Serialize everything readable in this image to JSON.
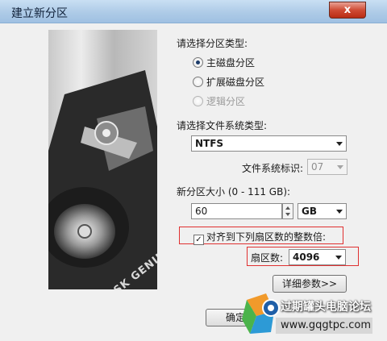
{
  "window": {
    "title": "建立新分区",
    "close_label": "x"
  },
  "side_image": {
    "brand": "DISK GENIUS"
  },
  "partition_type": {
    "label": "请选择分区类型:",
    "options": [
      {
        "label": "主磁盘分区",
        "checked": true,
        "enabled": true
      },
      {
        "label": "扩展磁盘分区",
        "checked": false,
        "enabled": true
      },
      {
        "label": "逻辑分区",
        "checked": false,
        "enabled": false
      }
    ]
  },
  "filesystem": {
    "label": "请选择文件系统类型:",
    "selected": "NTFS",
    "id_label": "文件系统标识:",
    "id_value": "07"
  },
  "size": {
    "label": "新分区大小 (0 - 111 GB):",
    "value": "60",
    "unit": "GB"
  },
  "alignment": {
    "checkbox_label": "对齐到下列扇区数的整数倍:",
    "checked": true,
    "sectors_label": "扇区数:",
    "sectors_value": "4096"
  },
  "buttons": {
    "details": "详细参数>>",
    "ok": "确定"
  },
  "watermark": {
    "site": "过期罐头电脑论坛",
    "url": "www.gqgtpc.com"
  }
}
